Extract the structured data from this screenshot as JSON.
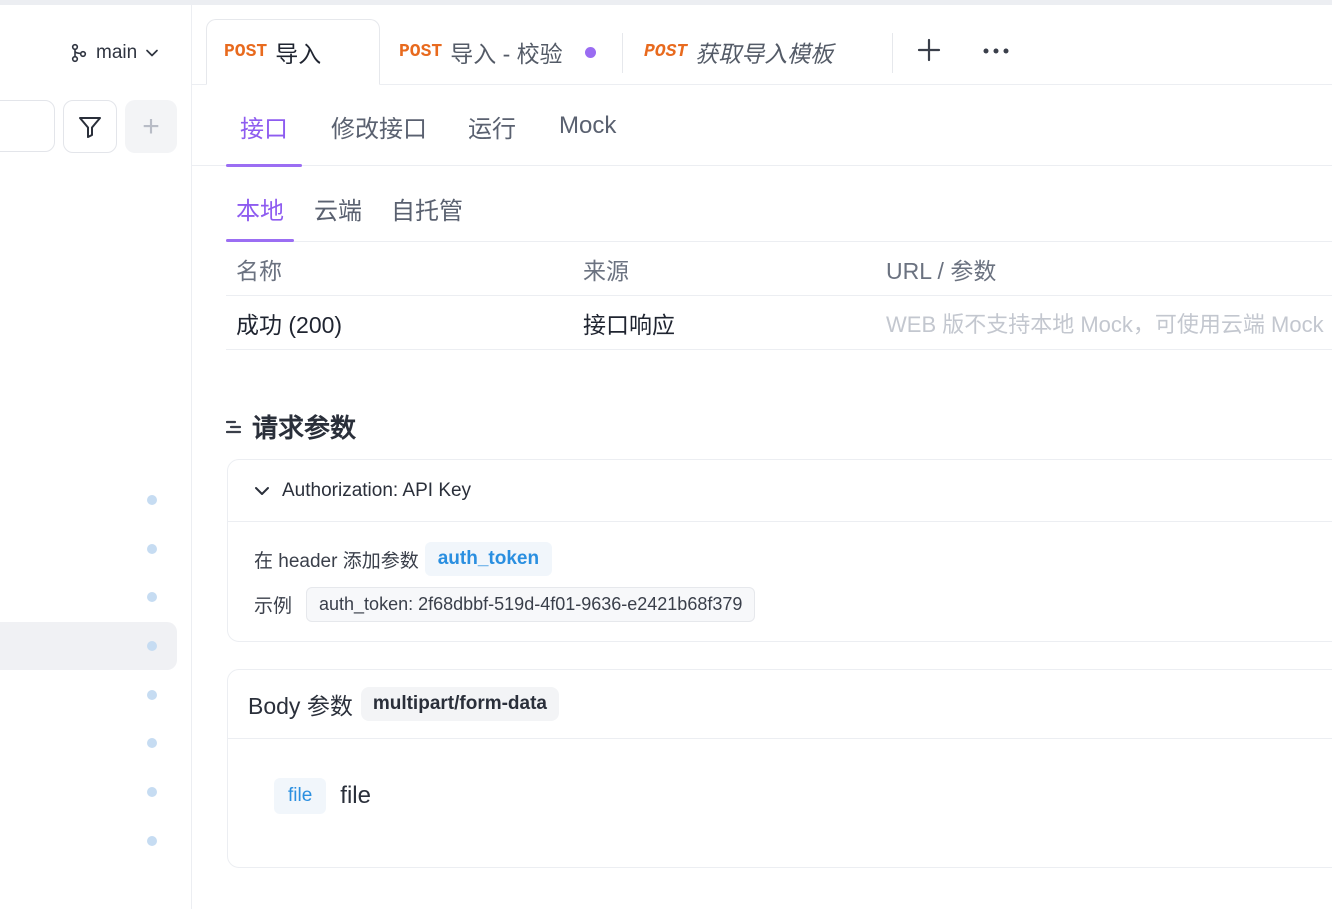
{
  "sidebar": {
    "branch": "main",
    "add_symbol": "+",
    "tree_row_count": 8,
    "selected_row_index": 3
  },
  "tabs": [
    {
      "method": "POST",
      "label": "导入",
      "active": true
    },
    {
      "method": "POST",
      "label": "导入 - 校验",
      "unsaved": true
    },
    {
      "method": "POST",
      "label": "获取导入模板",
      "preview": true
    }
  ],
  "subnav": {
    "items": [
      "接口",
      "修改接口",
      "运行",
      "Mock"
    ],
    "active": "接口"
  },
  "mock": {
    "tabs": [
      "本地",
      "云端",
      "自托管"
    ],
    "active": "本地",
    "columns": [
      "名称",
      "来源",
      "URL / 参数"
    ],
    "rows": [
      {
        "name": "成功 (200)",
        "source": "接口响应",
        "url": "WEB 版不支持本地 Mock，可使用云端 Mock"
      }
    ]
  },
  "request": {
    "title": "请求参数",
    "auth": {
      "header": "Authorization: API Key",
      "line1_prefix": "在 header 添加参数",
      "param": "auth_token",
      "example_label": "示例",
      "example_value": "auth_token: 2f68dbbf-519d-4f01-9636-e2421b68f379"
    },
    "body": {
      "title": "Body 参数",
      "content_type": "multipart/form-data",
      "params": [
        {
          "type": "file",
          "name": "file"
        }
      ]
    }
  },
  "colors": {
    "accent": "#8e5cf0",
    "method_post": "#e86a1e",
    "chip_blue": "#2a8fe0"
  }
}
